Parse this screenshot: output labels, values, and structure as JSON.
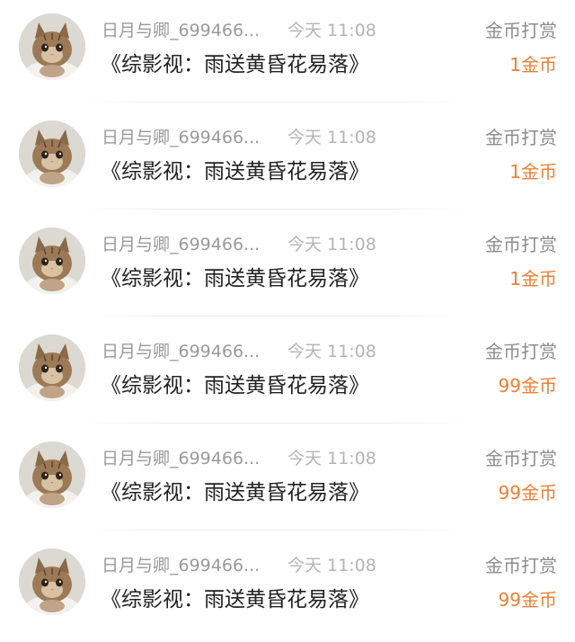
{
  "records": [
    {
      "user": "日月与卿_699466...",
      "time": "今天 11:08",
      "book": "《综影视：雨送黄昏花易落》",
      "type": "金币打赏",
      "amount": "1金币"
    },
    {
      "user": "日月与卿_699466...",
      "time": "今天 11:08",
      "book": "《综影视：雨送黄昏花易落》",
      "type": "金币打赏",
      "amount": "1金币"
    },
    {
      "user": "日月与卿_699466...",
      "time": "今天 11:08",
      "book": "《综影视：雨送黄昏花易落》",
      "type": "金币打赏",
      "amount": "1金币"
    },
    {
      "user": "日月与卿_699466...",
      "time": "今天 11:08",
      "book": "《综影视：雨送黄昏花易落》",
      "type": "金币打赏",
      "amount": "99金币"
    },
    {
      "user": "日月与卿_699466...",
      "time": "今天 11:08",
      "book": "《综影视：雨送黄昏花易落》",
      "type": "金币打赏",
      "amount": "99金币"
    },
    {
      "user": "日月与卿_699466...",
      "time": "今天 11:08",
      "book": "《综影视：雨送黄昏花易落》",
      "type": "金币打赏",
      "amount": "99金币"
    }
  ],
  "avatar_icon": "cat-avatar-icon",
  "colors": {
    "amount": "#ec7f31",
    "username": "#9a9a9a",
    "time": "#b4b4b4",
    "title": "#222222",
    "type": "#8c8c8c"
  }
}
